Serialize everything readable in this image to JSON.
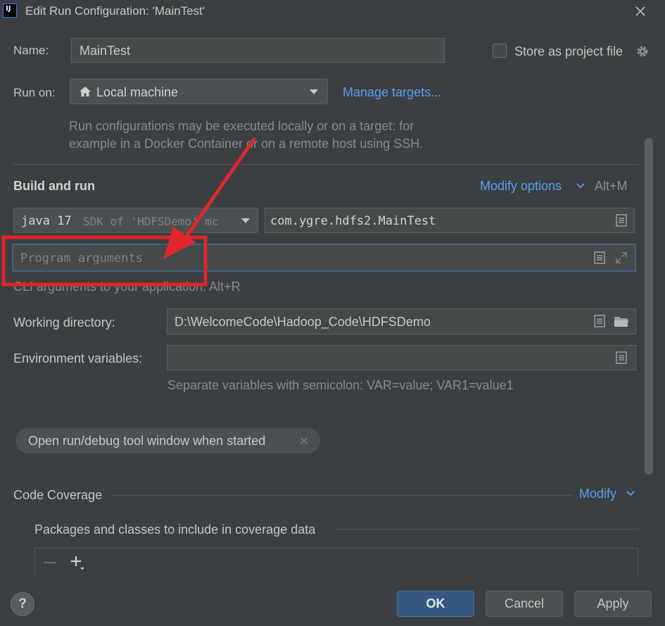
{
  "window": {
    "title": "Edit Run Configuration: 'MainTest'",
    "app_icon_text": "IJ"
  },
  "name": {
    "label": "Name:",
    "value": "MainTest"
  },
  "store": {
    "label": "Store as project file"
  },
  "run_on": {
    "label": "Run on:",
    "value": "Local machine",
    "manage_link": "Manage targets...",
    "hint_line1": "Run configurations may be executed locally or on a target: for",
    "hint_line2": "example in a Docker Container or on a remote host using SSH."
  },
  "build": {
    "heading": "Build and run",
    "modify_options": "Modify options",
    "shortcut": "Alt+M",
    "sdk_main": "java 17",
    "sdk_detail": "SDK of 'HDFSDemo' mc",
    "main_class": "com.ygre.hdfs2.MainTest",
    "program_args_placeholder": "Program arguments",
    "program_args_hint": "CLI arguments to your application. Alt+R"
  },
  "working_dir": {
    "label": "Working directory:",
    "value": "D:\\WelcomeCode\\Hadoop_Code\\HDFSDemo"
  },
  "env": {
    "label": "Environment variables:",
    "value": "",
    "hint": "Separate variables with semicolon: VAR=value; VAR1=value1"
  },
  "chip": {
    "label": "Open run/debug tool window when started"
  },
  "coverage": {
    "title": "Code Coverage",
    "modify": "Modify",
    "packages_label": "Packages and classes to include in coverage data"
  },
  "buttons": {
    "help": "?",
    "ok": "OK",
    "cancel": "Cancel",
    "apply": "Apply"
  },
  "colors": {
    "accent": "#589df6",
    "annotation": "#e0262a",
    "ok_button": "#365880"
  }
}
